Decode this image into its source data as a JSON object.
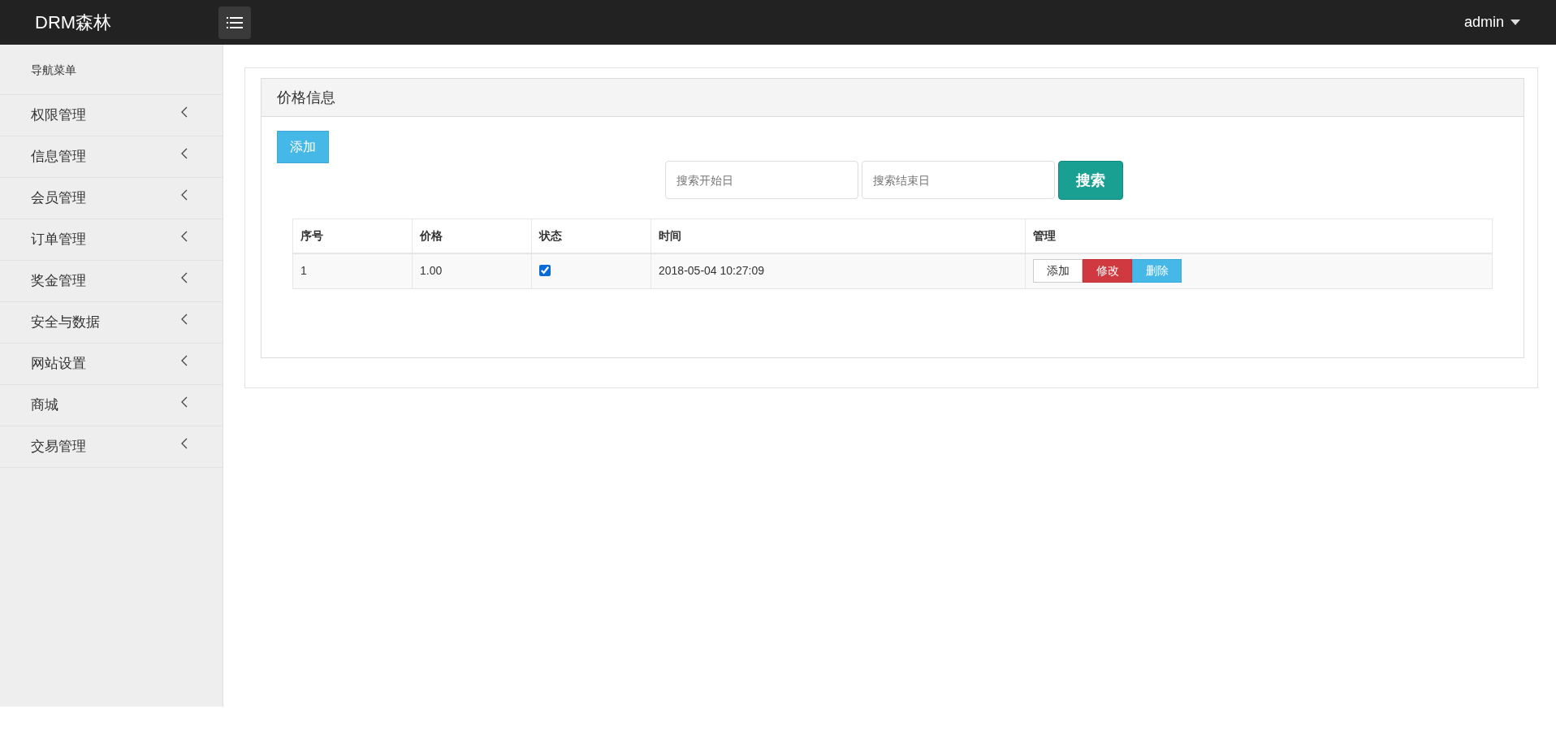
{
  "header": {
    "brand": "DRM森林",
    "user": "admin"
  },
  "sidebar": {
    "title": "导航菜单",
    "items": [
      {
        "label": "权限管理",
        "expanded": false
      },
      {
        "label": "信息管理",
        "expanded": false
      },
      {
        "label": "会员管理",
        "expanded": false
      },
      {
        "label": "订单管理",
        "expanded": false
      },
      {
        "label": "奖金管理",
        "expanded": false
      },
      {
        "label": "安全与数据",
        "expanded": false
      },
      {
        "label": "网站设置",
        "expanded": false
      },
      {
        "label": "商城",
        "expanded": false
      },
      {
        "label": "交易管理",
        "expanded": false
      }
    ]
  },
  "panel": {
    "title": "价格信息",
    "add_button": "添加",
    "search": {
      "start_placeholder": "搜索开始日",
      "end_placeholder": "搜索结束日",
      "button": "搜索"
    },
    "table": {
      "columns": [
        "序号",
        "价格",
        "状态",
        "时间",
        "管理"
      ],
      "rows": [
        {
          "index": "1",
          "price": "1.00",
          "checked": true,
          "time": "2018-05-04 10:27:09",
          "actions": [
            {
              "label": "添加",
              "kind": "default"
            },
            {
              "label": "修改",
              "kind": "danger"
            },
            {
              "label": "删除",
              "kind": "info"
            }
          ]
        }
      ]
    }
  }
}
